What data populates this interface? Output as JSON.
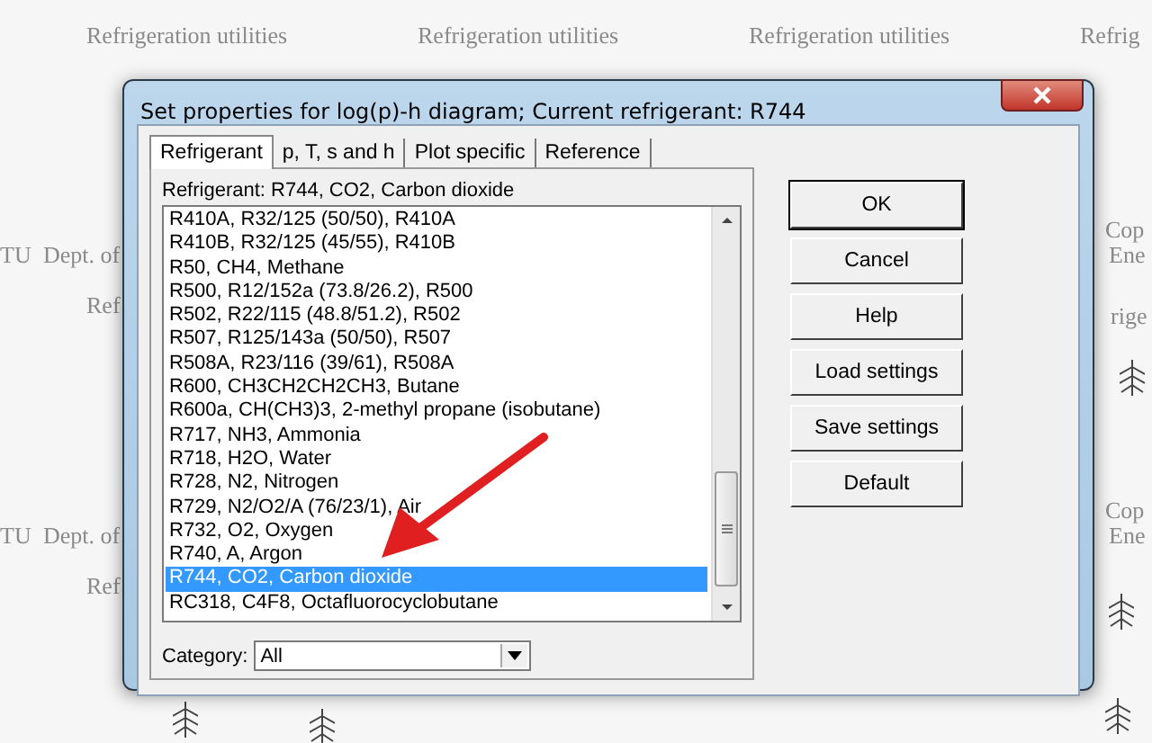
{
  "desktop": {
    "labels": [
      {
        "text": "Refrigeration utilities"
      },
      {
        "text": "Refrigeration utilities"
      },
      {
        "text": "Refrigeration utilities"
      },
      {
        "text": "Refrig"
      },
      {
        "text": "TU"
      },
      {
        "text": "Dept. of"
      },
      {
        "text": "Ref"
      },
      {
        "text": "TU"
      },
      {
        "text": "Dept. of"
      },
      {
        "text": "Ref"
      },
      {
        "text": "Cop"
      },
      {
        "text": "Ene"
      },
      {
        "text": "rige"
      },
      {
        "text": "Cop"
      },
      {
        "text": "Ene"
      }
    ]
  },
  "dialog": {
    "title": "Set properties for log(p)-h diagram; Current refrigerant: R744",
    "tabs": [
      {
        "label": "Refrigerant",
        "selected": true
      },
      {
        "label": "p, T, s and h",
        "selected": false
      },
      {
        "label": "Plot specific",
        "selected": false
      },
      {
        "label": "Reference",
        "selected": false
      }
    ],
    "refrigerant_label": "Refrigerant:  R744, CO2, Carbon dioxide",
    "list": [
      {
        "text": "R410A, R32/125 (50/50), R410A",
        "selected": false
      },
      {
        "text": "R410B, R32/125 (45/55), R410B",
        "selected": false
      },
      {
        "text": "R50, CH4, Methane",
        "selected": false
      },
      {
        "text": "R500, R12/152a (73.8/26.2), R500",
        "selected": false
      },
      {
        "text": "R502, R22/115 (48.8/51.2), R502",
        "selected": false
      },
      {
        "text": "R507, R125/143a (50/50), R507",
        "selected": false
      },
      {
        "text": "R508A, R23/116 (39/61), R508A",
        "selected": false
      },
      {
        "text": "R600, CH3CH2CH2CH3, Butane",
        "selected": false
      },
      {
        "text": "R600a, CH(CH3)3, 2-methyl propane (isobutane)",
        "selected": false
      },
      {
        "text": "R717, NH3, Ammonia",
        "selected": false
      },
      {
        "text": "R718, H2O, Water",
        "selected": false
      },
      {
        "text": "R728, N2, Nitrogen",
        "selected": false
      },
      {
        "text": "R729, N2/O2/A (76/23/1), Air",
        "selected": false
      },
      {
        "text": "R732, O2, Oxygen",
        "selected": false
      },
      {
        "text": "R740, A, Argon",
        "selected": false
      },
      {
        "text": "R744, CO2, Carbon dioxide",
        "selected": true
      },
      {
        "text": "RC318, C4F8, Octafluorocyclobutane",
        "selected": false
      }
    ],
    "category": {
      "label": "Category:",
      "value": "All"
    },
    "buttons": [
      {
        "label": "OK",
        "default": true
      },
      {
        "label": "Cancel",
        "default": false
      },
      {
        "label": "Help",
        "default": false
      },
      {
        "label": "Load settings",
        "default": false
      },
      {
        "label": "Save settings",
        "default": false
      },
      {
        "label": "Default",
        "default": false
      }
    ]
  }
}
